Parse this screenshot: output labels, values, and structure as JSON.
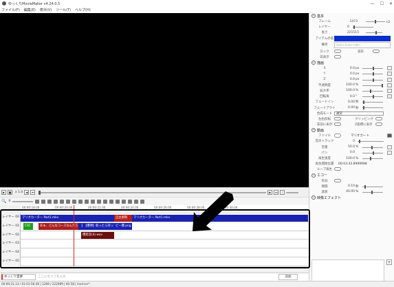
{
  "window": {
    "title": "ゆっくりMovieMaker v4.24.0.5",
    "minimize": "—",
    "maximize": "☐",
    "close": "✕"
  },
  "menu": [
    "ファイル(F)",
    "編集(E)",
    "表示(V)",
    "ツール(T)",
    "ヘルプ(H)"
  ],
  "props": {
    "section_basic": "基本",
    "frame_label": "フレーム",
    "frame_value": "1473",
    "layer_label": "レイヤー",
    "layer_value": "0",
    "length_label": "長さ",
    "length_value": "221515",
    "name_label": "アイテムの名",
    "memo_label": "備考",
    "memo_placeholder": "Shift+Enterで改行",
    "lock_label": "ロック",
    "hide_label": "非表示",
    "wave_label": "波形",
    "section_draw": "描画",
    "x_label": "X",
    "x_value": "0.0",
    "x_unit": "px",
    "y_label": "Y",
    "y_value": "0.0",
    "y_unit": "px",
    "z_label": "Z",
    "z_value": "0.0",
    "z_unit": "px",
    "opacity_label": "不透明度",
    "opacity_value": "100.0",
    "opacity_unit": "%",
    "zoom_label": "拡大率",
    "zoom_value": "100.0",
    "zoom_unit": "%",
    "rotation_label": "回転角",
    "rotation_value": "0.0",
    "rotation_unit": "°",
    "fadein_label": "フェードイン",
    "fadein_value": "0.00",
    "fadein_unit": "秒",
    "fadeout_label": "フェードアウト",
    "fadeout_value": "0.00",
    "fadeout_unit": "秒",
    "blend_label": "合成モード",
    "blend_value": "通常",
    "invert_label": "左右反転",
    "clipping_label": "クリッピング",
    "always_label": "非前に表示",
    "zoom2_label": "Z座標に表示",
    "section_video": "動画",
    "file_label": "ファイル",
    "file_value": "マリオカート",
    "track_label": "音声トラック",
    "track_value": "0",
    "volume_label": "音量",
    "volume_value": "50.0",
    "volume_unit": "%",
    "pan_label": "パン",
    "pan_value": "0.0",
    "speed_label": "再生速度",
    "speed_value": "100.0",
    "speed_unit": "%",
    "startpos_label": "再生開始位置",
    "startpos_value": "00:03:43.8999998",
    "loop_label": "ループ再生",
    "section_echo": "エコー",
    "echo_enable_label": "有効",
    "echo_interval_label": "間隔",
    "echo_interval_value": "0.10",
    "echo_interval_unit": "秒",
    "echo_decay_label": "減衰",
    "echo_decay_value": "40.00",
    "echo_decay_unit": "%",
    "section_effect": "映像エフェクト"
  },
  "playback": {
    "speed": "x 1.0"
  },
  "ruler": [
    "00:00:18.00",
    "00:00:20.00",
    "00:00:22.00",
    "00:00:24.00",
    "00:00:26.00",
    "00:00:28.00",
    "00:00:30.00"
  ],
  "lanes": [
    {
      "name": "レイヤー 00",
      "clips": [
        {
          "text": "マリオカーター Part1.mkv",
          "color": "#1a22b0"
        },
        {
          "text": "自主規制",
          "color": "#b42020"
        },
        {
          "text": "マリオカーター Part1.mkv",
          "color": "#1a22b0"
        }
      ]
    },
    {
      "name": "レイヤー 01",
      "clips": [
        {
          "text": "CXC",
          "color": "#1e9e1e"
        },
        {
          "text": "あぁ、どんなコースなんだろう！",
          "color": "#a82020"
        },
        {
          "text": "【爆弾】",
          "color": "#1a22b0"
        },
        {
          "text": "【爆弾】取ったら持ってる",
          "color": "#1a22b0"
        },
        {
          "text": "ビー爆.png",
          "color": "#1a22b0"
        }
      ]
    },
    {
      "name": "レイヤー 02",
      "clips": [
        {
          "text": "爆発音(4).wav",
          "color": "#6a0e0e"
        }
      ]
    },
    {
      "name": "レイヤー 03",
      "clips": []
    },
    {
      "name": "レイヤー 04",
      "clips": []
    },
    {
      "name": "レイヤー 05",
      "clips": []
    }
  ],
  "bottom": {
    "voice": "ゆっくり霊夢",
    "placeholder": "ここにセリフを入力",
    "add": "追加"
  },
  "status": "00:00:21.13 / 01:01:56.46 | 1268 / 222989 | 60.58 | mariner*"
}
